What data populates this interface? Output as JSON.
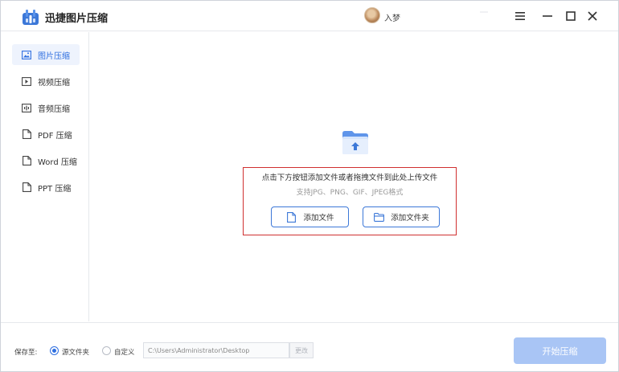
{
  "app": {
    "title": "迅捷图片压缩",
    "logo_icon": "app-logo-icon",
    "username": "入梦"
  },
  "window_controls": {
    "menu_icon": "hamburger-menu-icon",
    "minimize_icon": "minimize-icon",
    "maximize_icon": "maximize-icon",
    "close_icon": "close-icon"
  },
  "sidebar": {
    "items": [
      {
        "label": "图片压缩",
        "icon": "image-icon",
        "active": true
      },
      {
        "label": "视频压缩",
        "icon": "video-play-icon",
        "active": false
      },
      {
        "label": "音频压缩",
        "icon": "audio-icon",
        "active": false
      },
      {
        "label": "PDF 压缩",
        "icon": "pdf-icon",
        "active": false
      },
      {
        "label": "Word 压缩",
        "icon": "word-icon",
        "active": false
      },
      {
        "label": "PPT 压缩",
        "icon": "ppt-icon",
        "active": false
      }
    ]
  },
  "main": {
    "upload_icon": "folder-upload-icon",
    "drop_hint": "点击下方按钮添加文件或者拖拽文件到此处上传文件",
    "formats": "支持JPG、PNG、GIF、JPEG格式",
    "add_file_label": "添加文件",
    "add_file_icon": "file-icon",
    "add_folder_label": "添加文件夹",
    "add_folder_icon": "folder-icon"
  },
  "bottom": {
    "save_to_label": "保存至:",
    "option_source": "源文件夹",
    "option_custom": "自定义",
    "selected_option": "源文件夹",
    "path_value": "C:\\Users\\Administrator\\Desktop",
    "change_label": "更改",
    "start_label": "开始压缩"
  },
  "colors": {
    "accent": "#2f6fe0",
    "start_button": "#a9c5f5",
    "highlight_border": "#d03030",
    "active_nav_bg": "#eef3fd"
  }
}
